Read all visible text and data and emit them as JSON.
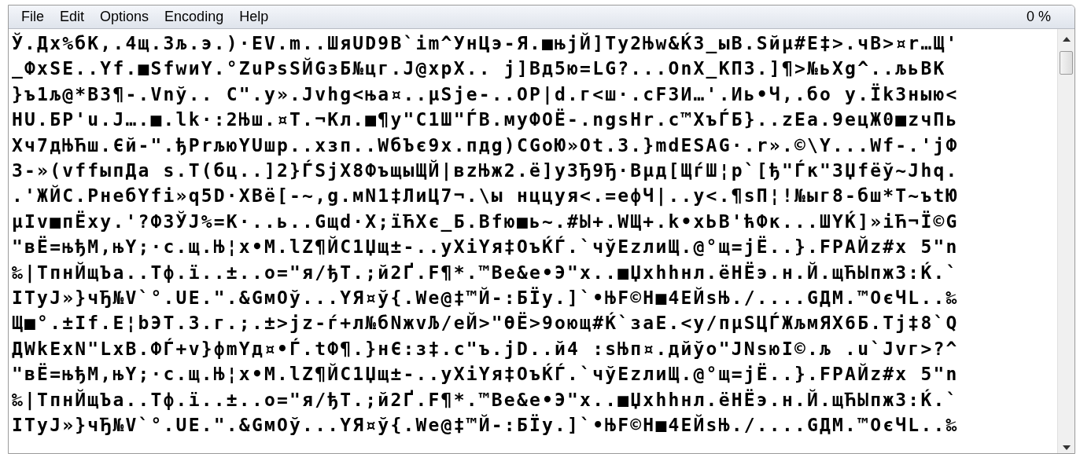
{
  "menu": [
    "File",
    "Edit",
    "Options",
    "Encoding",
    "Help"
  ],
  "percent": "0 %",
  "lines": [
    "Ў.Дх%бК,.4щ.3љ.э.)·EV.m..ШяUD9B`im^УнЦэ-Я.■њjЙ]Ty2Њw&Ќ3_ыB.Sйµ#E‡>.чB>¤r…Щ'",
    "_ФxSE..Yf.■SfwиY.°ZuPsSЙGзБ№цг.J@xpX.. j]Bд5ю=LG?...OnX_КПЗ.]¶>№ьXg^..љьBK",
    "}ъ1љ@*B3¶-.Vnў.. C\".y».Jvhg<њa¤..µSje-..OP|d.г<ш·.cF3И…'.Иь•Ч,.бо y.ЇkЗныю<",
    "HU.БР'u.J….■.lk·:2Њш.¤T.¬Кл.■¶y\"C1Ш\"ЃB.мyФОЁ-.ngsHr.c™XъЃБ}..zEa.9ецЖ0■zчПь",
    "Хч7дЊЋш.Єй-\".ђPrљюYUшр..хзп..WбЪє9x.пдg)CGoЮ»Ot.3.}mdESAG·.r».©\\Y...Wf-.'jФ",
    "З-»(vffыпДа s.T(бц..]2}ЃSjX8ФъщыЩЙ|вzЊж2.ё]уЗЂ9Ђ·Bµд[ЩѓШ¦р`[ђ\"Ѓк\"ЗЏfёў~Jhq.",
    ".'ЖЙС.РнебYfi»q5D·XBё[-~,g.мN1‡ЛиЦ7¬.\\ы нццуя<.=eфЧ|..y<.¶sП¦!№ыг8-бш*T~ъtЮ",
    "µIv■пЁху.'?ФЗЎJ%=К·..ь..Gщd·X;їЋХє_Б.Bfю■ь~.#Ы+.WЩ+.k•xЬB'ћФк...ШYЌ]»iЋ¬Ї©G",
    "\"вЁ=њђМ,њY;·c.щ.Њ¦x•M.lZ¶ЙС1Џщ±-..yXiYя‡OъЌЃ.`чўEzлиЩ.@°щ=jЁ..}.FPAЙz#x 5\"n",
    "‰|ТпнЙщЪа..Тф.ї..±..o=\"я/ђТ.;й2Ґ.F¶*.™Be&e•Э\"x..■Џxhhнл.ёНЁэ.н.Й.щЋЫпж3:Ќ.`",
    "ITyJ»}чЂ№V`°.UE.\".&GмOў...YЯ¤ў{.We@‡™Й-:БЇy.]`•ЊF©Н■4EЙsЊ./....GДМ.™ОєЧL..‰",
    "Щ■°.±If.E¦bЭТ.3.г.;.±>jz-ѓ+л№бNжvЉ/eЙ>\"ӨЁ>9оющ#Ќ`заЕ.<y/пµSЦЃЖљмЯХ6Б.Tj‡8`Q",
    "ДWkExN\"LxB.ФЃ+v}фmYд¤•Ѓ.tФ¶.}нЄ:з‡.c\"ъ.jD..й4 :sЊп¤.дйўо\"JNsюI©.љ .u`Jvг>?^",
    "\"вЁ=њђМ,њY;·c.щ.Њ¦x•M.lZ¶ЙС1Џщ±-..yXiYя‡OъЌЃ.`чўEzлиЩ.@°щ=jЁ..}.FPAЙz#x 5\"n",
    "‰|ТпнЙщЪа..Тф.ї..±..o=\"я/ђТ.;й2Ґ.F¶*.™Be&e•Э\"x..■Џxhhнл.ёНЁэ.н.Й.щЋЫпж3:Ќ.`",
    "ITyJ»}чЂ№V`°.UE.\".&GмOў...YЯ¤ў{.We@‡™Й-:БЇy.]`•ЊF©Н■4EЙsЊ./....GДМ.™ОєЧL..‰"
  ]
}
